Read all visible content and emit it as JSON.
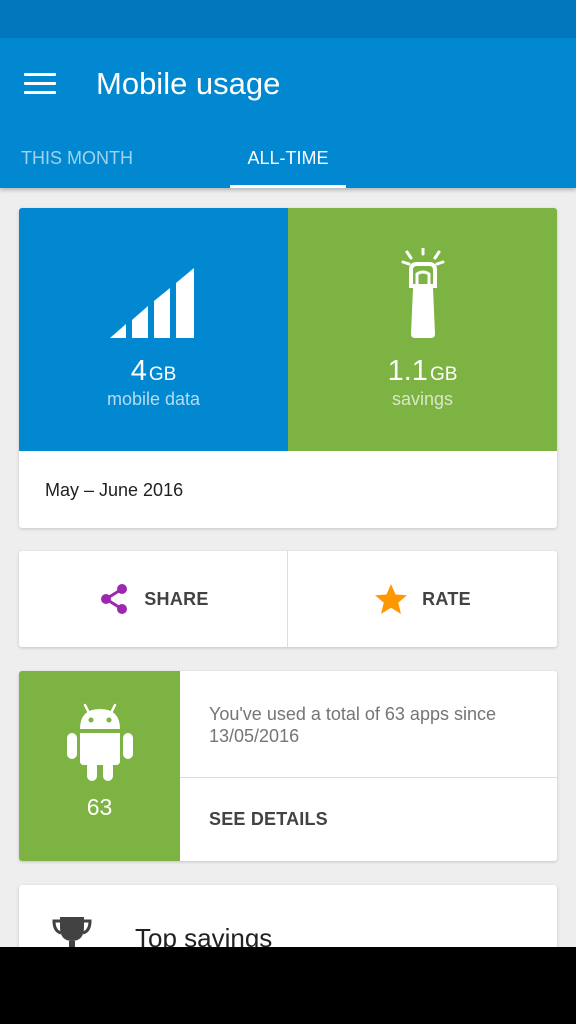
{
  "app_bar": {
    "title": "Mobile usage"
  },
  "tabs": [
    {
      "label": "THIS MONTH",
      "selected": false
    },
    {
      "label": "ALL-TIME",
      "selected": true
    }
  ],
  "usage": {
    "data": {
      "value": "4",
      "unit": "GB",
      "label": "mobile data",
      "icon": "signal-bars-icon"
    },
    "savings": {
      "value": "1.1",
      "unit": "GB",
      "label": "savings",
      "icon": "savings-clip-icon"
    },
    "date_range": "May – June 2016"
  },
  "actions": {
    "share_label": "SHARE",
    "rate_label": "RATE"
  },
  "apps": {
    "count": "63",
    "description": "You've used a total of 63 apps since 13/05/2016",
    "details_label": "SEE DETAILS"
  },
  "top_savings": {
    "title": "Top savings"
  },
  "colors": {
    "primary": "#0288d1",
    "status_bar": "#0277bd",
    "green": "#7cb342",
    "share_purple": "#9c27b0",
    "star_orange": "#ff9800"
  }
}
